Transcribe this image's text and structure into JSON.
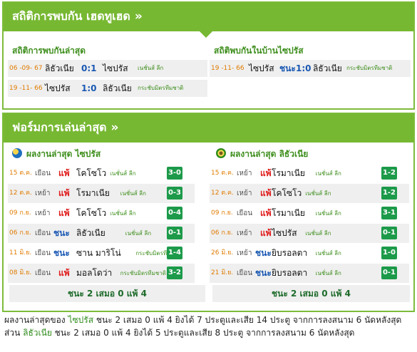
{
  "h2h": {
    "title": "สถิติการพบกัน เฮดทูเฮด",
    "arrow": "»",
    "left_subtitle": "สถิติการพบกันล่าสุด",
    "right_subtitle": "สถิติพบกันในบ้านไซปรัส",
    "left_matches": [
      {
        "date": "06 -09- 67",
        "home": "ลิธัวเนีย",
        "score": "0:1",
        "away": "ไซปรัส",
        "comp": "เนชั่นส์ ลีก"
      },
      {
        "date": "19 -11- 66",
        "home": "ไซปรัส",
        "score": "1:0",
        "away": "ลิธัวเนีย",
        "comp": "กระชับมิตรทีมชาติ"
      }
    ],
    "right_matches": [
      {
        "date": "19 -11- 66",
        "home": "ไซปรัส",
        "result": "ชนะ",
        "score": "1:0",
        "away": "ลิธัวเนีย",
        "comp": "กระชับมิตรทีมชาติ"
      }
    ]
  },
  "form": {
    "title": "ฟอร์มการเล่นล่าสุด",
    "arrow": "»",
    "left_subtitle": "ผลงานล่าสุด ไซปรัส",
    "right_subtitle": "ผลงานล่าสุด ลิธัวเนีย",
    "left_rows": [
      {
        "date": "15 ต.ค.",
        "ha": "เยือน",
        "wl": "แพ้",
        "opp": "โคโซโว",
        "comp": "เนชั่นส์ ลีก",
        "score": "3-0"
      },
      {
        "date": "12 ต.ค.",
        "ha": "เหย้า",
        "wl": "แพ้",
        "opp": "โรมาเนีย",
        "comp": "เนชั่นส์ ลีก",
        "score": "0-3"
      },
      {
        "date": "09 ก.ย.",
        "ha": "เหย้า",
        "wl": "แพ้",
        "opp": "โคโซโว",
        "comp": "เนชั่นส์ ลีก",
        "score": "0-4"
      },
      {
        "date": "06 ก.ย.",
        "ha": "เยือน",
        "wl": "ชนะ",
        "opp": "ลิธัวเนีย",
        "comp": "เนชั่นส์ ลีก",
        "score": "0-1"
      },
      {
        "date": "11 มิ.ย.",
        "ha": "เยือน",
        "wl": "ชนะ",
        "opp": "ซาน มาริโน่",
        "comp": "กระชับมิตรทีมชาติ",
        "score": "1-4"
      },
      {
        "date": "08 มิ.ย.",
        "ha": "เยือน",
        "wl": "แพ้",
        "opp": "มอลโดว่า",
        "comp": "กระชับมิตรทีมชาติ",
        "score": "3-2"
      }
    ],
    "right_rows": [
      {
        "date": "15 ต.ค.",
        "ha": "เหย้า",
        "wl": "แพ้",
        "opp": "โรมาเนีย",
        "comp": "เนชั่นส์ ลีก",
        "score": "1-2"
      },
      {
        "date": "12 ต.ค.",
        "ha": "เหย้า",
        "wl": "แพ้",
        "opp": "โคโซโว",
        "comp": "เนชั่นส์ ลีก",
        "score": "1-2"
      },
      {
        "date": "09 ก.ย.",
        "ha": "เยือน",
        "wl": "แพ้",
        "opp": "โรมาเนีย",
        "comp": "เนชั่นส์ ลีก",
        "score": "3-1"
      },
      {
        "date": "06 ก.ย.",
        "ha": "เหย้า",
        "wl": "แพ้",
        "opp": "ไซปรัส",
        "comp": "เนชั่นส์ ลีก",
        "score": "0-1"
      },
      {
        "date": "26 มิ.ย.",
        "ha": "เหย้า",
        "wl": "ชนะ",
        "opp": "ยิบรอลตา",
        "comp": "เนชั่นส์ ลีก",
        "score": "1-0"
      },
      {
        "date": "21 มิ.ย.",
        "ha": "เยือน",
        "wl": "ชนะ",
        "opp": "ยิบรอลตา",
        "comp": "เนชั่นส์ ลีก",
        "score": "0-1"
      }
    ],
    "left_summary": "ชนะ 2 เสมอ 0 แพ้ 4",
    "right_summary": "ชนะ 2 เสมอ 0 แพ้ 4"
  },
  "footer": {
    "p1": "ผลงานล่าสุดของ ",
    "team1": "ไซปรัส",
    "p2": " ชนะ 2 เสมอ 0 แพ้ 4 ยิงได้ 7 ประตูและเสีย 14 ประตู จากการลงสนาม 6 นัดหลังสุด ส่วน ",
    "team2": "ลิธัวเนีย",
    "p3": " ชนะ 2 เสมอ 0 แพ้ 4 ยิงได้ 5 ประตูและเสีย 8 ประตู จากการลงสนาม 6 นัดหลังสุด"
  },
  "colors": {
    "green": "#77b832",
    "loss": "#e01b1b",
    "win": "#1a58b3",
    "badge": "#1c9a4a",
    "date": "#e07b00"
  }
}
